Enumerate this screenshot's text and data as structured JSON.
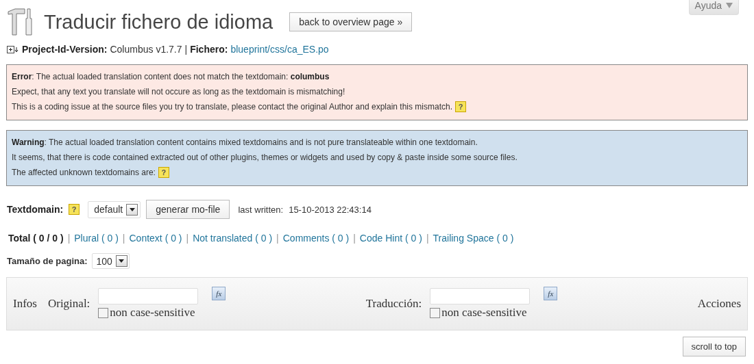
{
  "help_tab": {
    "label": "Ayuda"
  },
  "header": {
    "title": "Traducir fichero de idioma",
    "back_button": "back to overview page »"
  },
  "project": {
    "version_label": "Project-Id-Version:",
    "version": "Columbus v1.7.7",
    "separator": "|",
    "file_label": "Fichero:",
    "file_link": "blueprint/css/ca_ES.po"
  },
  "notices": [
    {
      "kind": "error",
      "lines": [
        "**Error**: The actual loaded translation content does not match the textdomain: **columbus**",
        "Expect, that any text you translate will not occure as long as the textdomain is mismatching!",
        "This is a coding issue at the source files you try to translate, please contact the original Author and explain this mismatch."
      ],
      "help_mark": "?"
    },
    {
      "kind": "warning",
      "lines": [
        "**Warning**: The actual loaded translation content contains mixed textdomains and is not pure translateable within one textdomain.",
        "It seems, that there is code contained extracted out of other plugins, themes or widgets and used by copy & paste inside some source files.",
        "The affected unknown textdomains are:"
      ],
      "help_mark": "?"
    }
  ],
  "textdomain": {
    "label": "Textdomain:",
    "help_mark": "?",
    "value": "default",
    "generate_button": "generar mo-file",
    "last_written_label": "last written:",
    "last_written": "15-10-2013 22:43:14"
  },
  "filters": [
    {
      "label": "Total ( 0 / 0 )",
      "selected": true
    },
    {
      "label": "Plural ( 0 )",
      "selected": false
    },
    {
      "label": "Context ( 0 )",
      "selected": false
    },
    {
      "label": "Not translated ( 0 )",
      "selected": false
    },
    {
      "label": "Comments ( 0 )",
      "selected": false
    },
    {
      "label": "Code Hint ( 0 )",
      "selected": false
    },
    {
      "label": "Trailing Space ( 0 )",
      "selected": false
    }
  ],
  "filter_separator": "|",
  "page_size": {
    "label": "Tamaño de pagina:",
    "value": "100"
  },
  "search_table": {
    "infos": "Infos",
    "original_label": "Original:",
    "translation_label": "Traducción:",
    "actions": "Acciones",
    "case_options": [
      {
        "label": "non case-sensitive",
        "checked": false,
        "fx_label": "fx"
      },
      {
        "label": "non case-sensitive",
        "checked": false,
        "fx_label": "fx"
      }
    ]
  },
  "scroll_button": "scroll to top"
}
